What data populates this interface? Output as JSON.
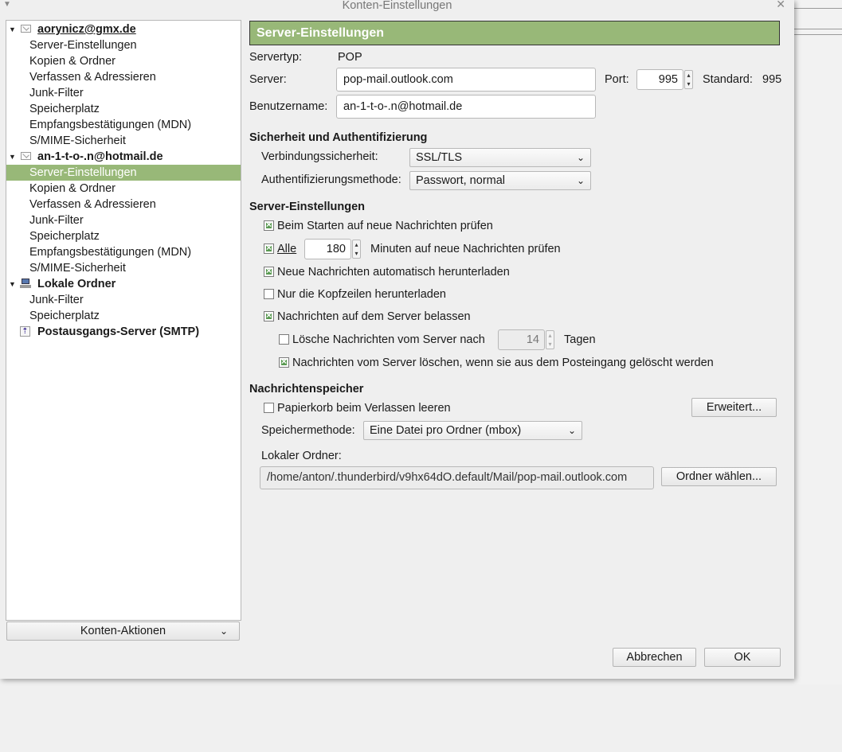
{
  "window": {
    "title": "Konten-Einstellungen"
  },
  "tree": {
    "accounts": [
      {
        "name": "aorynicz@gmx.de",
        "items": [
          "Server-Einstellungen",
          "Kopien & Ordner",
          "Verfassen & Adressieren",
          "Junk-Filter",
          "Speicherplatz",
          "Empfangsbestätigungen (MDN)",
          "S/MIME-Sicherheit"
        ]
      },
      {
        "name": "an-1-t-o-.n@hotmail.de",
        "items": [
          "Server-Einstellungen",
          "Kopien & Ordner",
          "Verfassen & Adressieren",
          "Junk-Filter",
          "Speicherplatz",
          "Empfangsbestätigungen (MDN)",
          "S/MIME-Sicherheit"
        ]
      },
      {
        "name": "Lokale Ordner",
        "items": [
          "Junk-Filter",
          "Speicherplatz"
        ]
      },
      {
        "name": "Postausgangs-Server (SMTP)",
        "items": []
      }
    ],
    "selected": "Server-Einstellungen"
  },
  "account_actions": {
    "label": "Konten-Aktionen"
  },
  "header": {
    "title": "Server-Einstellungen"
  },
  "server": {
    "type_label": "Servertyp:",
    "type_value": "POP",
    "server_label": "Server:",
    "server_value": "pop-mail.outlook.com",
    "port_label": "Port:",
    "port_value": "995",
    "standard_label": "Standard:",
    "standard_value": "995",
    "username_label": "Benutzername:",
    "username_value": "an-1-t-o-.n@hotmail.de"
  },
  "security": {
    "heading": "Sicherheit und Authentifizierung",
    "connection_label": "Verbindungssicherheit:",
    "connection_value": "SSL/TLS",
    "auth_label": "Authentifizierungsmethode:",
    "auth_value": "Passwort, normal"
  },
  "server_settings": {
    "heading": "Server-Einstellungen",
    "check_on_start": "Beim Starten auf neue Nachrichten prüfen",
    "every_label": "Alle",
    "every_minutes": "180",
    "minutes_suffix": "Minuten auf neue Nachrichten prüfen",
    "auto_download": "Neue Nachrichten automatisch herunterladen",
    "headers_only": "Nur die Kopfzeilen herunterladen",
    "leave_on_server": "Nachrichten auf dem Server belassen",
    "delete_after_label": "Lösche Nachrichten vom Server nach",
    "delete_after_days": "14",
    "days_suffix": "Tagen",
    "delete_when_deleted": "Nachrichten vom Server löschen, wenn sie aus dem Posteingang gelöscht werden",
    "checks": {
      "check_on_start": true,
      "every": true,
      "auto_download": true,
      "headers_only": false,
      "leave_on_server": true,
      "delete_after": false,
      "delete_when_deleted": true
    }
  },
  "storage": {
    "heading": "Nachrichtenspeicher",
    "empty_trash": "Papierkorb beim Verlassen leeren",
    "empty_trash_checked": false,
    "advanced_button": "Erweitert...",
    "method_label": "Speichermethode:",
    "method_value": "Eine Datei pro Ordner (mbox)",
    "local_folder_label": "Lokaler Ordner:",
    "local_folder_value": "/home/anton/.thunderbird/v9hx64dO.default/Mail/pop-mail.outlook.com",
    "choose_folder_button": "Ordner wählen..."
  },
  "footer": {
    "cancel": "Abbrechen",
    "ok": "OK"
  }
}
